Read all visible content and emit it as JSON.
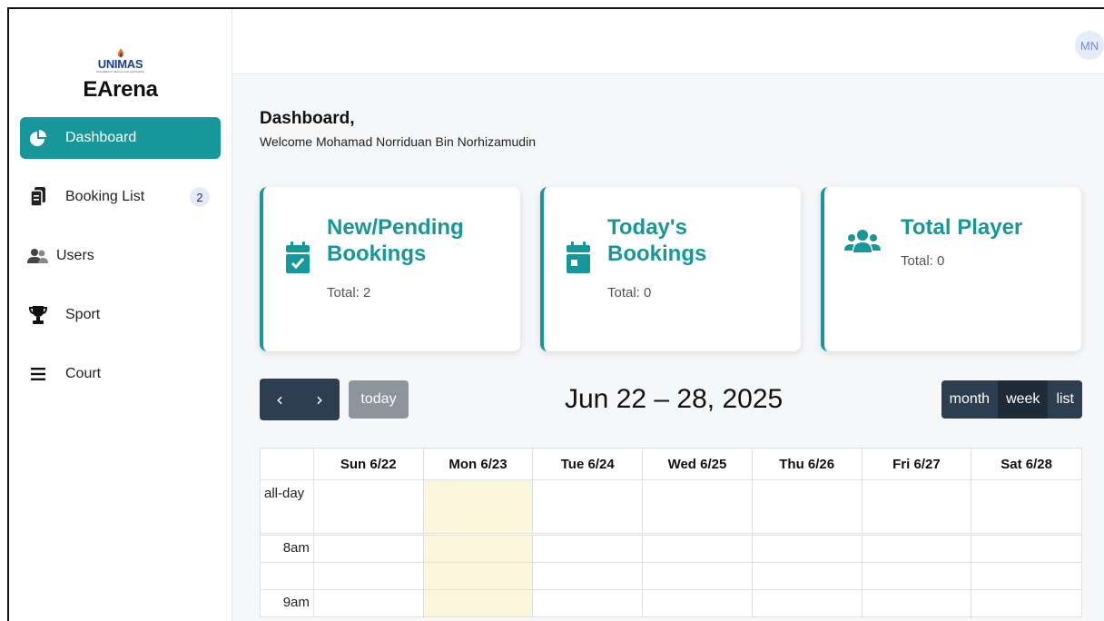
{
  "brand": {
    "logo_text": "UNIMAS",
    "logo_subtext": "UNIVERSITI MALAYSIA SARAWAK",
    "app_name": "EArena"
  },
  "sidebar": {
    "items": [
      {
        "label": "Dashboard",
        "icon": "pie-chart-icon",
        "active": true
      },
      {
        "label": "Booking List",
        "icon": "clipboard-icon",
        "badge": "2"
      },
      {
        "label": "Users",
        "icon": "users-icon"
      },
      {
        "label": "Sport",
        "icon": "trophy-icon"
      },
      {
        "label": "Court",
        "icon": "list-icon"
      }
    ]
  },
  "header": {
    "avatar_initials": "MN"
  },
  "page": {
    "title": "Dashboard,",
    "welcome": "Welcome Mohamad Norriduan Bin Norhizamudin"
  },
  "cards": [
    {
      "title_line1": "New/Pending",
      "title_line2": "Bookings",
      "total": "Total: 2",
      "icon": "calendar-check-icon"
    },
    {
      "title_line1": "Today's",
      "title_line2": "Bookings",
      "total": "Total: 0",
      "icon": "calendar-day-icon"
    },
    {
      "title_line1": "Total Player",
      "title_line2": "",
      "total": "Total: 0",
      "icon": "users-icon"
    }
  ],
  "calendar": {
    "prev_symbol": "‹",
    "next_symbol": "›",
    "today_label": "today",
    "title": "Jun 22 – 28, 2025",
    "views": [
      "month",
      "week",
      "list"
    ],
    "active_view": "week",
    "days": [
      "Sun 6/22",
      "Mon 6/23",
      "Tue 6/24",
      "Wed 6/25",
      "Thu 6/26",
      "Fri 6/27",
      "Sat 6/28"
    ],
    "today_column": "Mon 6/23",
    "allday_label": "all-day",
    "times": [
      "8am",
      "9am"
    ],
    "colors": {
      "accent": "#17979a",
      "toolbar": "#2c3e50",
      "today_highlight": "#fbf6dc"
    }
  }
}
